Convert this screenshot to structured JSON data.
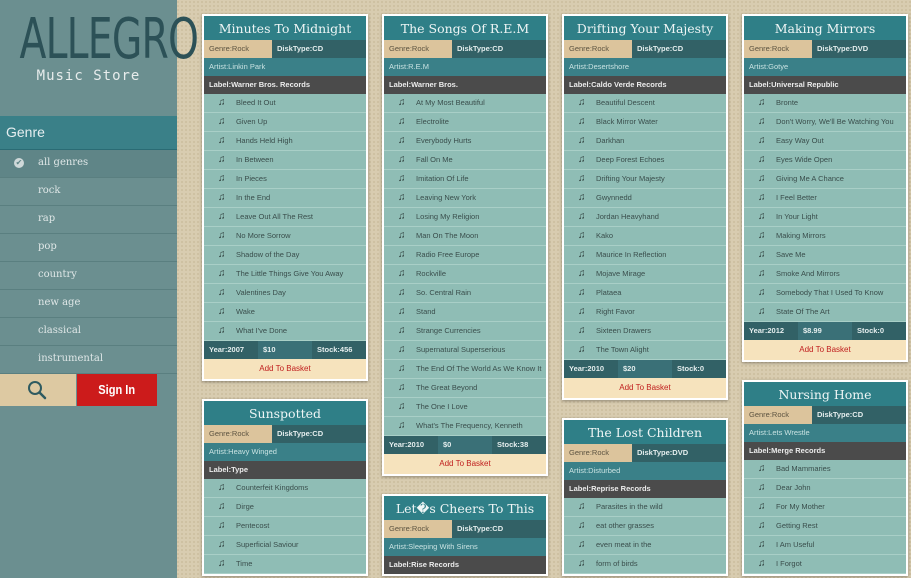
{
  "app": {
    "title": "ALLEGRO",
    "subtitle": "Music Store"
  },
  "sidebar": {
    "genre_heading": "Genre",
    "genres": [
      "all genres",
      "rock",
      "rap",
      "pop",
      "country",
      "new age",
      "classical",
      "instrumental"
    ],
    "active_genre": "all genres",
    "sign_in_label": "Sign In",
    "search_icon": "search-icon"
  },
  "labels": {
    "add_to_basket": "Add To Basket"
  },
  "albums": [
    {
      "title": "Minutes To Midnight",
      "genre": "Genre:Rock",
      "disk": "DiskType:CD",
      "artist": "Artist:Linkin Park",
      "label": "Label:Warner Bros. Records",
      "tracks": [
        "Bleed It Out",
        "Given Up",
        "Hands Held High",
        "In Between",
        "In Pieces",
        "In the End",
        "Leave Out All The Rest",
        "No More Sorrow",
        "Shadow of the Day",
        "The Little Things Give You Away",
        "Valentines Day",
        "Wake",
        "What I've Done"
      ],
      "year": "Year:2007",
      "price": "$10",
      "stock": "Stock:456"
    },
    {
      "title": "The Songs Of R.E.M",
      "genre": "Genre:Rock",
      "disk": "DiskType:CD",
      "artist": "Artist:R.E.M",
      "label": "Label:Warner Bros.",
      "tracks": [
        "At My Most Beautiful",
        "Electrolite",
        "Everybody Hurts",
        "Fall On Me",
        "Imitation Of Life",
        "Leaving New York",
        "Losing My Religion",
        "Man On The Moon",
        "Radio Free Europe",
        "Rockville",
        "So. Central Rain",
        "Stand",
        "Strange Currencies",
        "Supernatural Superserious",
        "The End Of The World As We Know It",
        "The Great Beyond",
        "The One I Love",
        "What's The Frequency, Kenneth"
      ],
      "year": "Year:2010",
      "price": "$0",
      "stock": "Stock:38"
    },
    {
      "title": "Drifting Your Majesty",
      "genre": "Genre:Rock",
      "disk": "DiskType:CD",
      "artist": "Artist:Desertshore",
      "label": "Label:Caldo Verde Records",
      "tracks": [
        "Beautiful Descent",
        "Black Mirror Water",
        "Darkhan",
        "Deep Forest Echoes",
        "Drifting Your Majesty",
        "Gwynnedd",
        "Jordan Heavyhand",
        "Kako",
        "Maurice In Reflection",
        "Mojave Mirage",
        "Plataea",
        "Right Favor",
        "Sixteen Drawers",
        "The Town Alight"
      ],
      "year": "Year:2010",
      "price": "$20",
      "stock": "Stock:0"
    },
    {
      "title": "Making Mirrors",
      "genre": "Genre:Rock",
      "disk": "DiskType:DVD",
      "artist": "Artist:Gotye",
      "label": "Label:Universal Republic",
      "tracks": [
        "Bronte",
        "Don't Worry, We'll Be Watching You",
        "Easy Way Out",
        "Eyes Wide Open",
        "Giving Me A Chance",
        "I Feel Better",
        "In Your Light",
        "Making Mirrors",
        "Save Me",
        "Smoke And Mirrors",
        "Somebody That I Used To Know",
        "State Of The Art"
      ],
      "year": "Year:2012",
      "price": "$8.99",
      "stock": "Stock:0"
    },
    {
      "title": "Sunspotted",
      "genre": "Genre:Rock",
      "disk": "DiskType:CD",
      "artist": "Artist:Heavy Winged",
      "label": "Label:Type",
      "tracks": [
        "Counterfeit Kingdoms",
        "Dirge",
        "Pentecost",
        "Superficial Saviour",
        "Time"
      ]
    },
    {
      "title": "Let�s Cheers To This",
      "genre": "Genre:Rock",
      "disk": "DiskType:CD",
      "artist": "Artist:Sleeping With Sirens",
      "label": "Label:Rise Records",
      "tracks": []
    },
    {
      "title": "The Lost Children",
      "genre": "Genre:Rock",
      "disk": "DiskType:DVD",
      "artist": "Artist:Disturbed",
      "label": "Label:Reprise Records",
      "tracks": [
        "Parasites in the wild",
        "eat other grasses",
        "even meat in the",
        "form of birds"
      ]
    },
    {
      "title": "Nursing Home",
      "genre": "Genre:Rock",
      "disk": "DiskType:CD",
      "artist": "Artist:Lets Wrestle",
      "label": "Label:Merge Records",
      "tracks": [
        "Bad Mammaries",
        "Dear John",
        "For My Mother",
        "Getting Rest",
        "I Am Useful",
        "I Forgot"
      ]
    }
  ]
}
